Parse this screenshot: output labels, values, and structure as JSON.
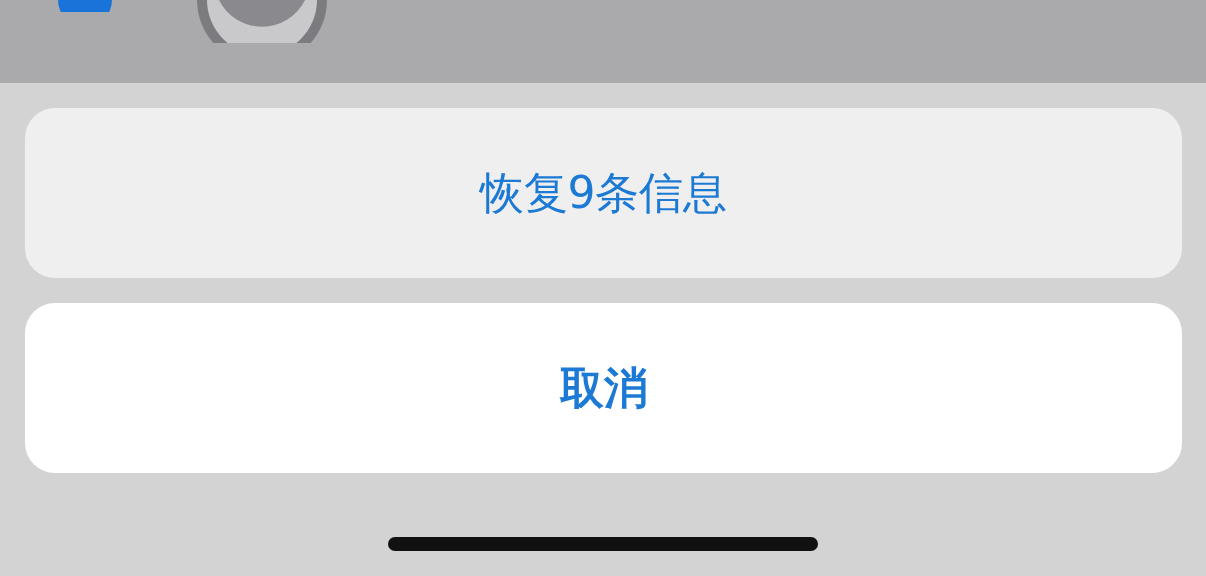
{
  "actions": [
    {
      "label": "恢复9条信息",
      "kind": "action"
    },
    {
      "label": "取消",
      "kind": "cancel"
    }
  ]
}
